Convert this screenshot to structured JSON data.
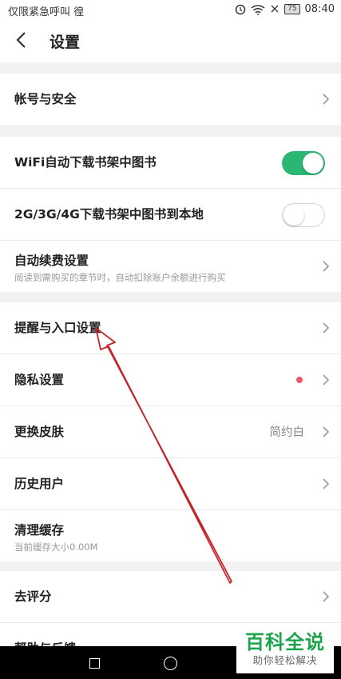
{
  "status": {
    "left_text": "仅限紧急呼叫 徨",
    "battery": "75",
    "time": "08:40"
  },
  "header": {
    "title": "设置"
  },
  "sections": {
    "account": {
      "label": "帐号与安全"
    },
    "wifi": {
      "label": "WiFi自动下载书架中图书",
      "toggle": "on"
    },
    "mobile": {
      "label": "2G/3G/4G下载书架中图书到本地",
      "toggle": "off"
    },
    "autorenew": {
      "label": "自动续费设置",
      "sub": "阅读到需购买的章节时，自动扣除账户余额进行购买"
    },
    "reminder": {
      "label": "提醒与入口设置"
    },
    "privacy": {
      "label": "隐私设置"
    },
    "skin": {
      "label": "更换皮肤",
      "value": "简约白"
    },
    "history": {
      "label": "历史用户"
    },
    "cache": {
      "label": "清理缓存",
      "sub": "当前缓存大小0.00M"
    },
    "rate": {
      "label": "去评分"
    },
    "help": {
      "label": "帮助与反馈"
    }
  },
  "watermark": {
    "main": "百科全说",
    "sub": "助你轻松解决"
  },
  "colors": {
    "toggle_on": "#2bb673",
    "badge": "#f2556a",
    "arrow": "#c0262b",
    "watermark": "#1aa34a"
  },
  "icons": [
    "chevron-left-icon",
    "chevron-right-icon",
    "wifi-icon",
    "battery-icon",
    "alarm-icon"
  ]
}
